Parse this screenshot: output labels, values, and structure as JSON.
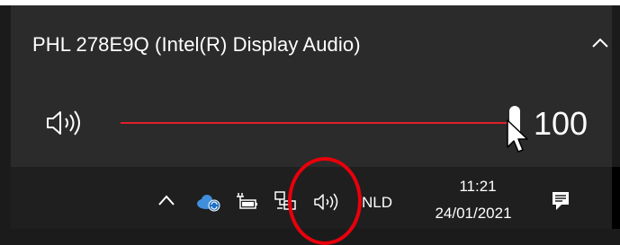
{
  "flyout": {
    "device_name": "PHL 278E9Q (Intel(R) Display Audio)",
    "volume": {
      "value_label": "100",
      "level": 1.0
    },
    "colors": {
      "slider_fill": "#e2202a",
      "thumb": "#ffffff"
    }
  },
  "taskbar": {
    "tray_icons": [
      "chevron-up-icon",
      "onedrive-cloud-icon",
      "battery-icon",
      "network-icon",
      "speaker-icon"
    ],
    "language": "NLD",
    "clock": {
      "time": "11:21",
      "date": "24/01/2021"
    },
    "notification_icon": "action-center-icon"
  },
  "annotation": {
    "highlight_color": "#e8000b"
  }
}
